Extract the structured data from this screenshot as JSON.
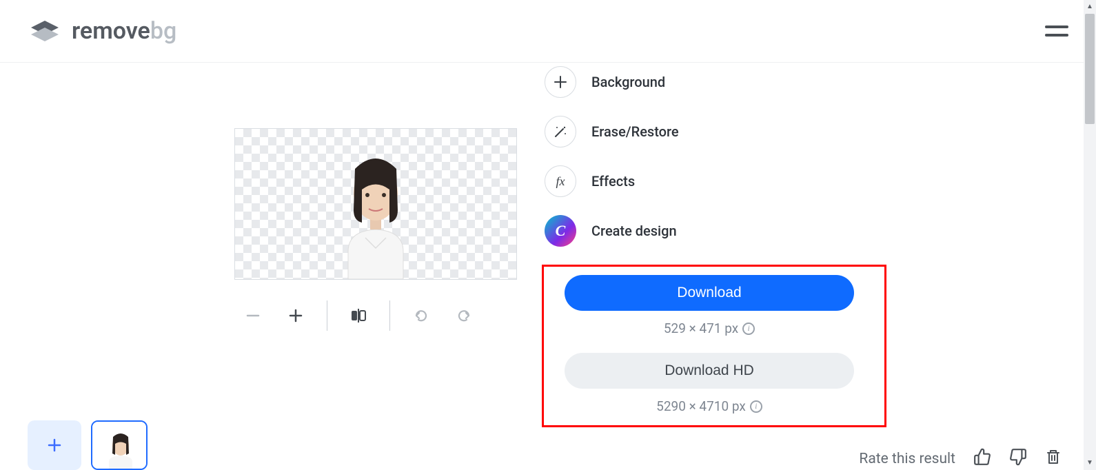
{
  "header": {
    "logo_main": "remove",
    "logo_suffix": "bg"
  },
  "edit_options": {
    "background": "Background",
    "erase_restore": "Erase/Restore",
    "effects": "Effects",
    "create_design": "Create design",
    "canva_letter": "C"
  },
  "downloads": {
    "standard_label": "Download",
    "standard_dims": "529 × 471 px",
    "hd_label": "Download HD",
    "hd_dims": "5290 × 4710 px"
  },
  "footer": {
    "rate_label": "Rate this result"
  },
  "effects_fx": "fx"
}
